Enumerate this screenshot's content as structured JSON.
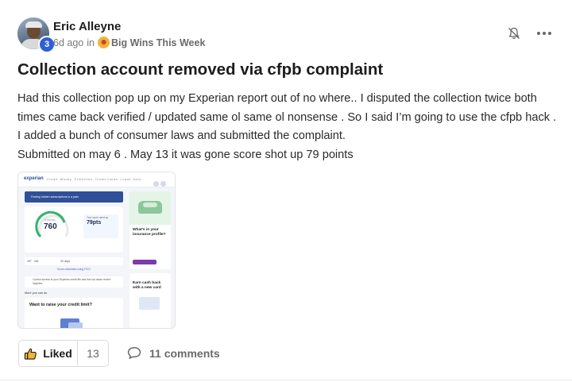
{
  "post": {
    "author": {
      "name": "Eric Alleyne",
      "level": "3"
    },
    "meta": {
      "time": "6d ago",
      "in_label": "in",
      "group_icon": "party-face-icon",
      "group_name": "Big Wins This Week"
    },
    "title": "Collection account removed via cfpb complaint",
    "body": [
      "Had this collection pop up on my Experian report out of no where.. I disputed the collection twice both times came back verified / updated same ol same ol nonsense . So I said I’m going to use the cfpb hack . I added a bunch of consumer laws and submitted the complaint.",
      "Submitted on may 6 . May 13 it was gone score shot up 79 points"
    ],
    "attachment": {
      "score": "760",
      "points": "79pts",
      "raise_title": "Want to raise your credit limit?",
      "ad_title": "What's in your insurance profile?",
      "ad2_title": "Earn cash back with a new card"
    },
    "actions": {
      "like_label": "Liked",
      "like_count": "13",
      "comments_label": "11 comments"
    },
    "colors": {
      "badge": "#2f5fd6",
      "text": "#1c1c1c",
      "muted": "#7a7a7a"
    }
  }
}
